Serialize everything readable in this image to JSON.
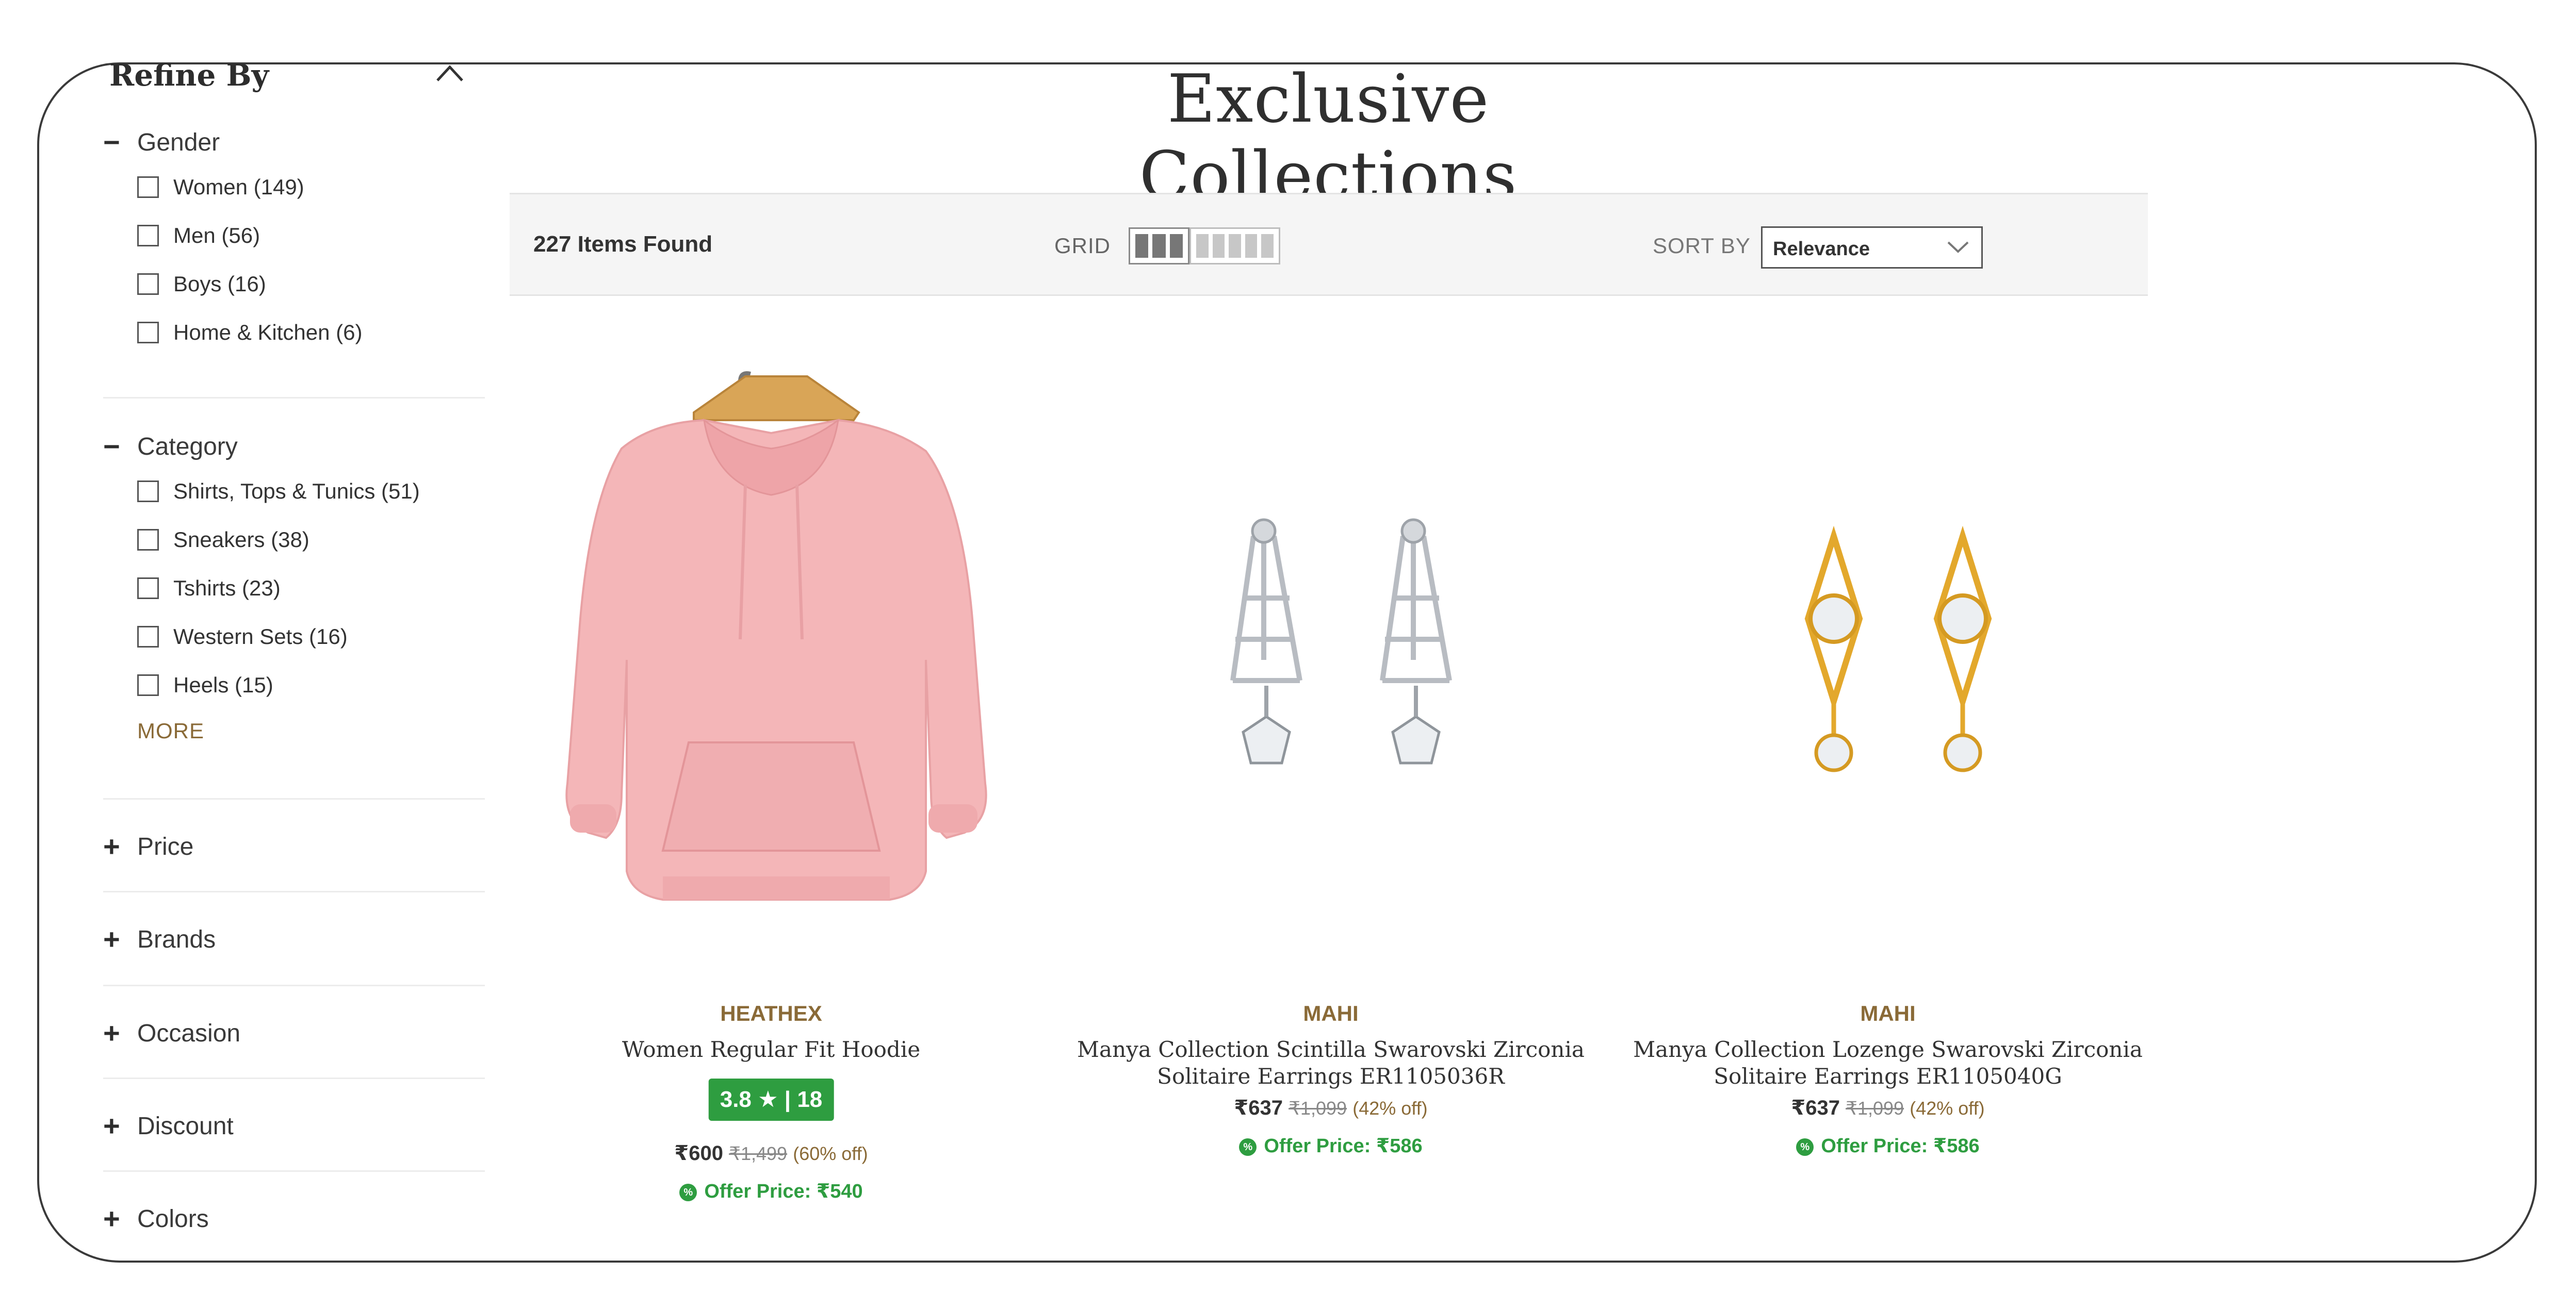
{
  "refine": {
    "title": "Refine By"
  },
  "filters": {
    "gender": {
      "label": "Gender",
      "sign": "−",
      "options": [
        "Women (149)",
        "Men (56)",
        "Boys (16)",
        "Home & Kitchen (6)"
      ]
    },
    "category": {
      "label": "Category",
      "sign": "−",
      "options": [
        "Shirts, Tops & Tunics (51)",
        "Sneakers (38)",
        "Tshirts (23)",
        "Western Sets (16)",
        "Heels (15)"
      ],
      "more": "MORE"
    },
    "collapsed": [
      {
        "label": "Price",
        "sign": "+"
      },
      {
        "label": "Brands",
        "sign": "+"
      },
      {
        "label": "Occasion",
        "sign": "+"
      },
      {
        "label": "Discount",
        "sign": "+"
      },
      {
        "label": "Colors",
        "sign": "+"
      }
    ]
  },
  "main": {
    "title": "Exclusive Collections",
    "items_found": "227 Items Found",
    "grid_label": "GRID",
    "sort_label": "SORT BY",
    "sort_value": "Relevance"
  },
  "products": [
    {
      "brand": "HEATHEX",
      "name": "Women Regular Fit Hoodie",
      "rating": "3.8 ★ | 18",
      "price": "₹600",
      "mrp": "₹1,499",
      "discount": "(60% off)",
      "offer": "Offer Price: ₹540"
    },
    {
      "brand": "MAHI",
      "name": "Manya Collection Scintilla Swarovski Zirconia Solitaire Earrings ER1105036R",
      "price": "₹637",
      "mrp": "₹1,099",
      "discount": "(42% off)",
      "offer": "Offer Price: ₹586"
    },
    {
      "brand": "MAHI",
      "name": "Manya Collection Lozenge Swarovski Zirconia Solitaire Earrings ER1105040G",
      "price": "₹637",
      "mrp": "₹1,099",
      "discount": "(42% off)",
      "offer": "Offer Price: ₹586"
    }
  ],
  "colors": {
    "accent_gold": "#8a6a37",
    "rating_green": "#2e9d40",
    "hoodie_pink": "#f4b6b8"
  },
  "icons": {
    "collapse": "chevron-up-icon",
    "sort": "chevron-down-icon",
    "offer": "offer-badge-icon"
  }
}
